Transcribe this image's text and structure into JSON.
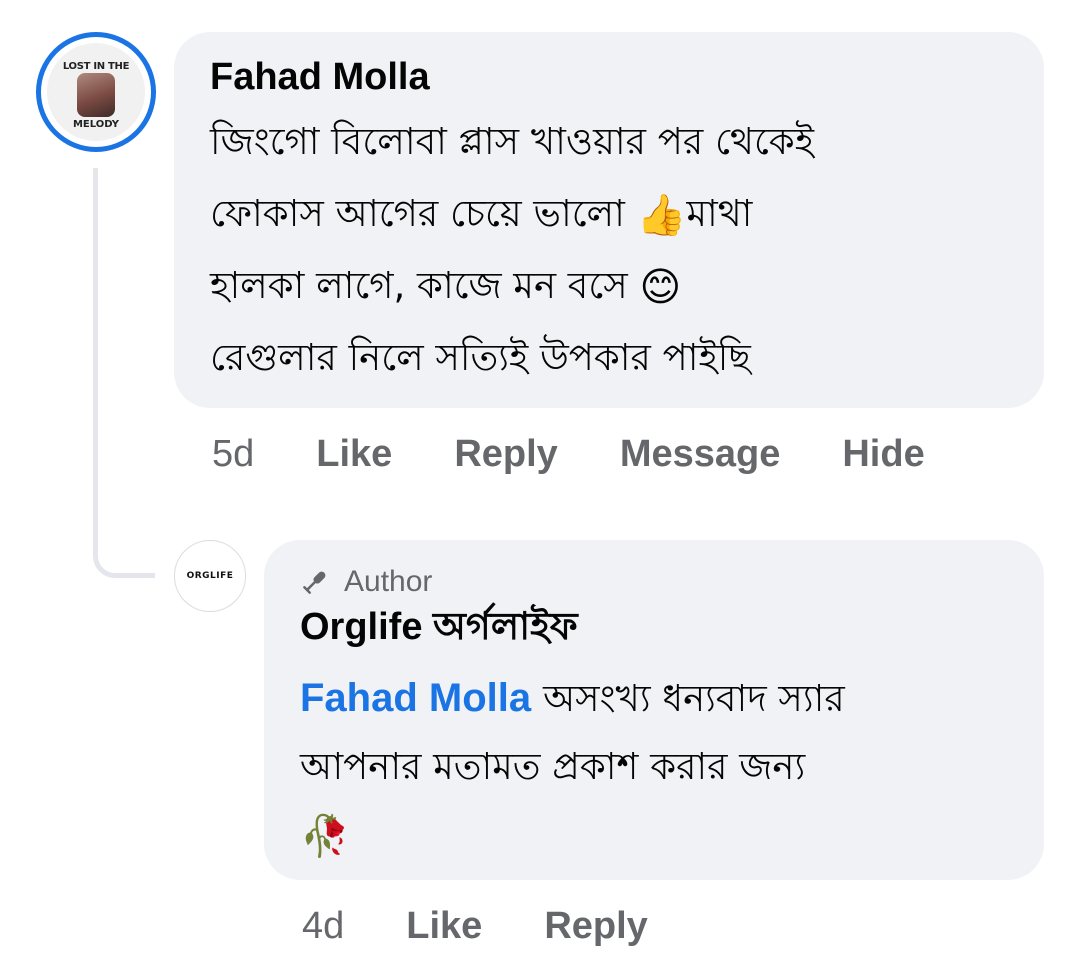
{
  "main_comment": {
    "avatar_logo_top": "LOST IN THE",
    "avatar_logo_bottom": "MELODY",
    "author": "Fahad Molla",
    "lines": [
      "জিংগো বিলোবা প্লাস খাওয়ার পর থেকেই",
      "ফোকাস আগের চেয়ে ভালো",
      "মাথা",
      "হালকা লাগে, কাজে মন বসে",
      "রেগুলার নিলে সত্যিই উপকার পাইছি"
    ],
    "emoji_thumbs": "👍",
    "emoji_smile": "😊",
    "time": "5d",
    "actions": {
      "like": "Like",
      "reply": "Reply",
      "message": "Message",
      "hide": "Hide"
    }
  },
  "reply_comment": {
    "avatar_logo": "ORGLIFE",
    "badge": "Author",
    "author": "Orglife অর্গলাইফ",
    "mention": "Fahad Molla",
    "lines": [
      "অসংখ্য ধন্যবাদ স্যার",
      "আপনার মতামত প্রকাশ করার জন্য"
    ],
    "emoji_rose": "🥀",
    "time": "4d",
    "actions": {
      "like": "Like",
      "reply": "Reply"
    }
  },
  "colors": {
    "bubble": "#f0f2f5",
    "text": "#050505",
    "secondary": "#65676b",
    "link": "#1b74e4",
    "avatar_ring": "#1b74e4",
    "thread_line": "#e4e6eb"
  },
  "icons": {
    "author_badge": "microphone-icon"
  }
}
